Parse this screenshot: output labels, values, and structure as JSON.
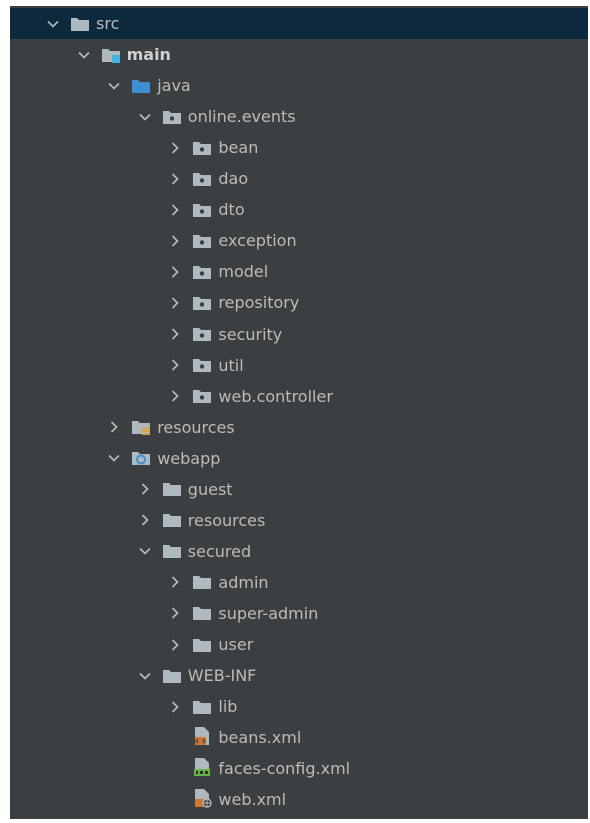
{
  "tree": [
    {
      "label": "src",
      "depth": 0,
      "expanded": true,
      "icon": "folder-icon",
      "selected": true
    },
    {
      "label": "main",
      "depth": 1,
      "expanded": true,
      "icon": "module-folder-icon",
      "bold": true
    },
    {
      "label": "java",
      "depth": 2,
      "expanded": true,
      "icon": "source-root-folder-icon"
    },
    {
      "label": "online.events",
      "depth": 3,
      "expanded": true,
      "icon": "package-icon"
    },
    {
      "label": "bean",
      "depth": 4,
      "expanded": false,
      "icon": "package-icon"
    },
    {
      "label": "dao",
      "depth": 4,
      "expanded": false,
      "icon": "package-icon"
    },
    {
      "label": "dto",
      "depth": 4,
      "expanded": false,
      "icon": "package-icon"
    },
    {
      "label": "exception",
      "depth": 4,
      "expanded": false,
      "icon": "package-icon"
    },
    {
      "label": "model",
      "depth": 4,
      "expanded": false,
      "icon": "package-icon"
    },
    {
      "label": "repository",
      "depth": 4,
      "expanded": false,
      "icon": "package-icon"
    },
    {
      "label": "security",
      "depth": 4,
      "expanded": false,
      "icon": "package-icon"
    },
    {
      "label": "util",
      "depth": 4,
      "expanded": false,
      "icon": "package-icon"
    },
    {
      "label": "web.controller",
      "depth": 4,
      "expanded": false,
      "icon": "package-icon"
    },
    {
      "label": "resources",
      "depth": 2,
      "expanded": false,
      "icon": "resources-root-folder-icon"
    },
    {
      "label": "webapp",
      "depth": 2,
      "expanded": true,
      "icon": "web-folder-icon"
    },
    {
      "label": "guest",
      "depth": 3,
      "expanded": false,
      "icon": "folder-icon"
    },
    {
      "label": "resources",
      "depth": 3,
      "expanded": false,
      "icon": "folder-icon"
    },
    {
      "label": "secured",
      "depth": 3,
      "expanded": true,
      "icon": "folder-icon"
    },
    {
      "label": "admin",
      "depth": 4,
      "expanded": false,
      "icon": "folder-icon"
    },
    {
      "label": "super-admin",
      "depth": 4,
      "expanded": false,
      "icon": "folder-icon"
    },
    {
      "label": "user",
      "depth": 4,
      "expanded": false,
      "icon": "folder-icon"
    },
    {
      "label": "WEB-INF",
      "depth": 3,
      "expanded": true,
      "icon": "folder-icon"
    },
    {
      "label": "lib",
      "depth": 4,
      "expanded": false,
      "icon": "folder-icon"
    },
    {
      "label": "beans.xml",
      "depth": 4,
      "expanded": null,
      "icon": "xml-file-icon"
    },
    {
      "label": "faces-config.xml",
      "depth": 4,
      "expanded": null,
      "icon": "jsf-config-file-icon"
    },
    {
      "label": "web.xml",
      "depth": 4,
      "expanded": null,
      "icon": "web-xml-file-icon"
    }
  ],
  "colors": {
    "background": "#3c3f41",
    "selection": "#0d293e",
    "text": "#bbbbbb",
    "folder": "#aeb9c0",
    "source_root": "#3d8fd1",
    "module_badge": "#40b6e0",
    "resources_badge": "#d9a343",
    "xml_badge": "#cc7832",
    "jsf_badge": "#62b543"
  }
}
